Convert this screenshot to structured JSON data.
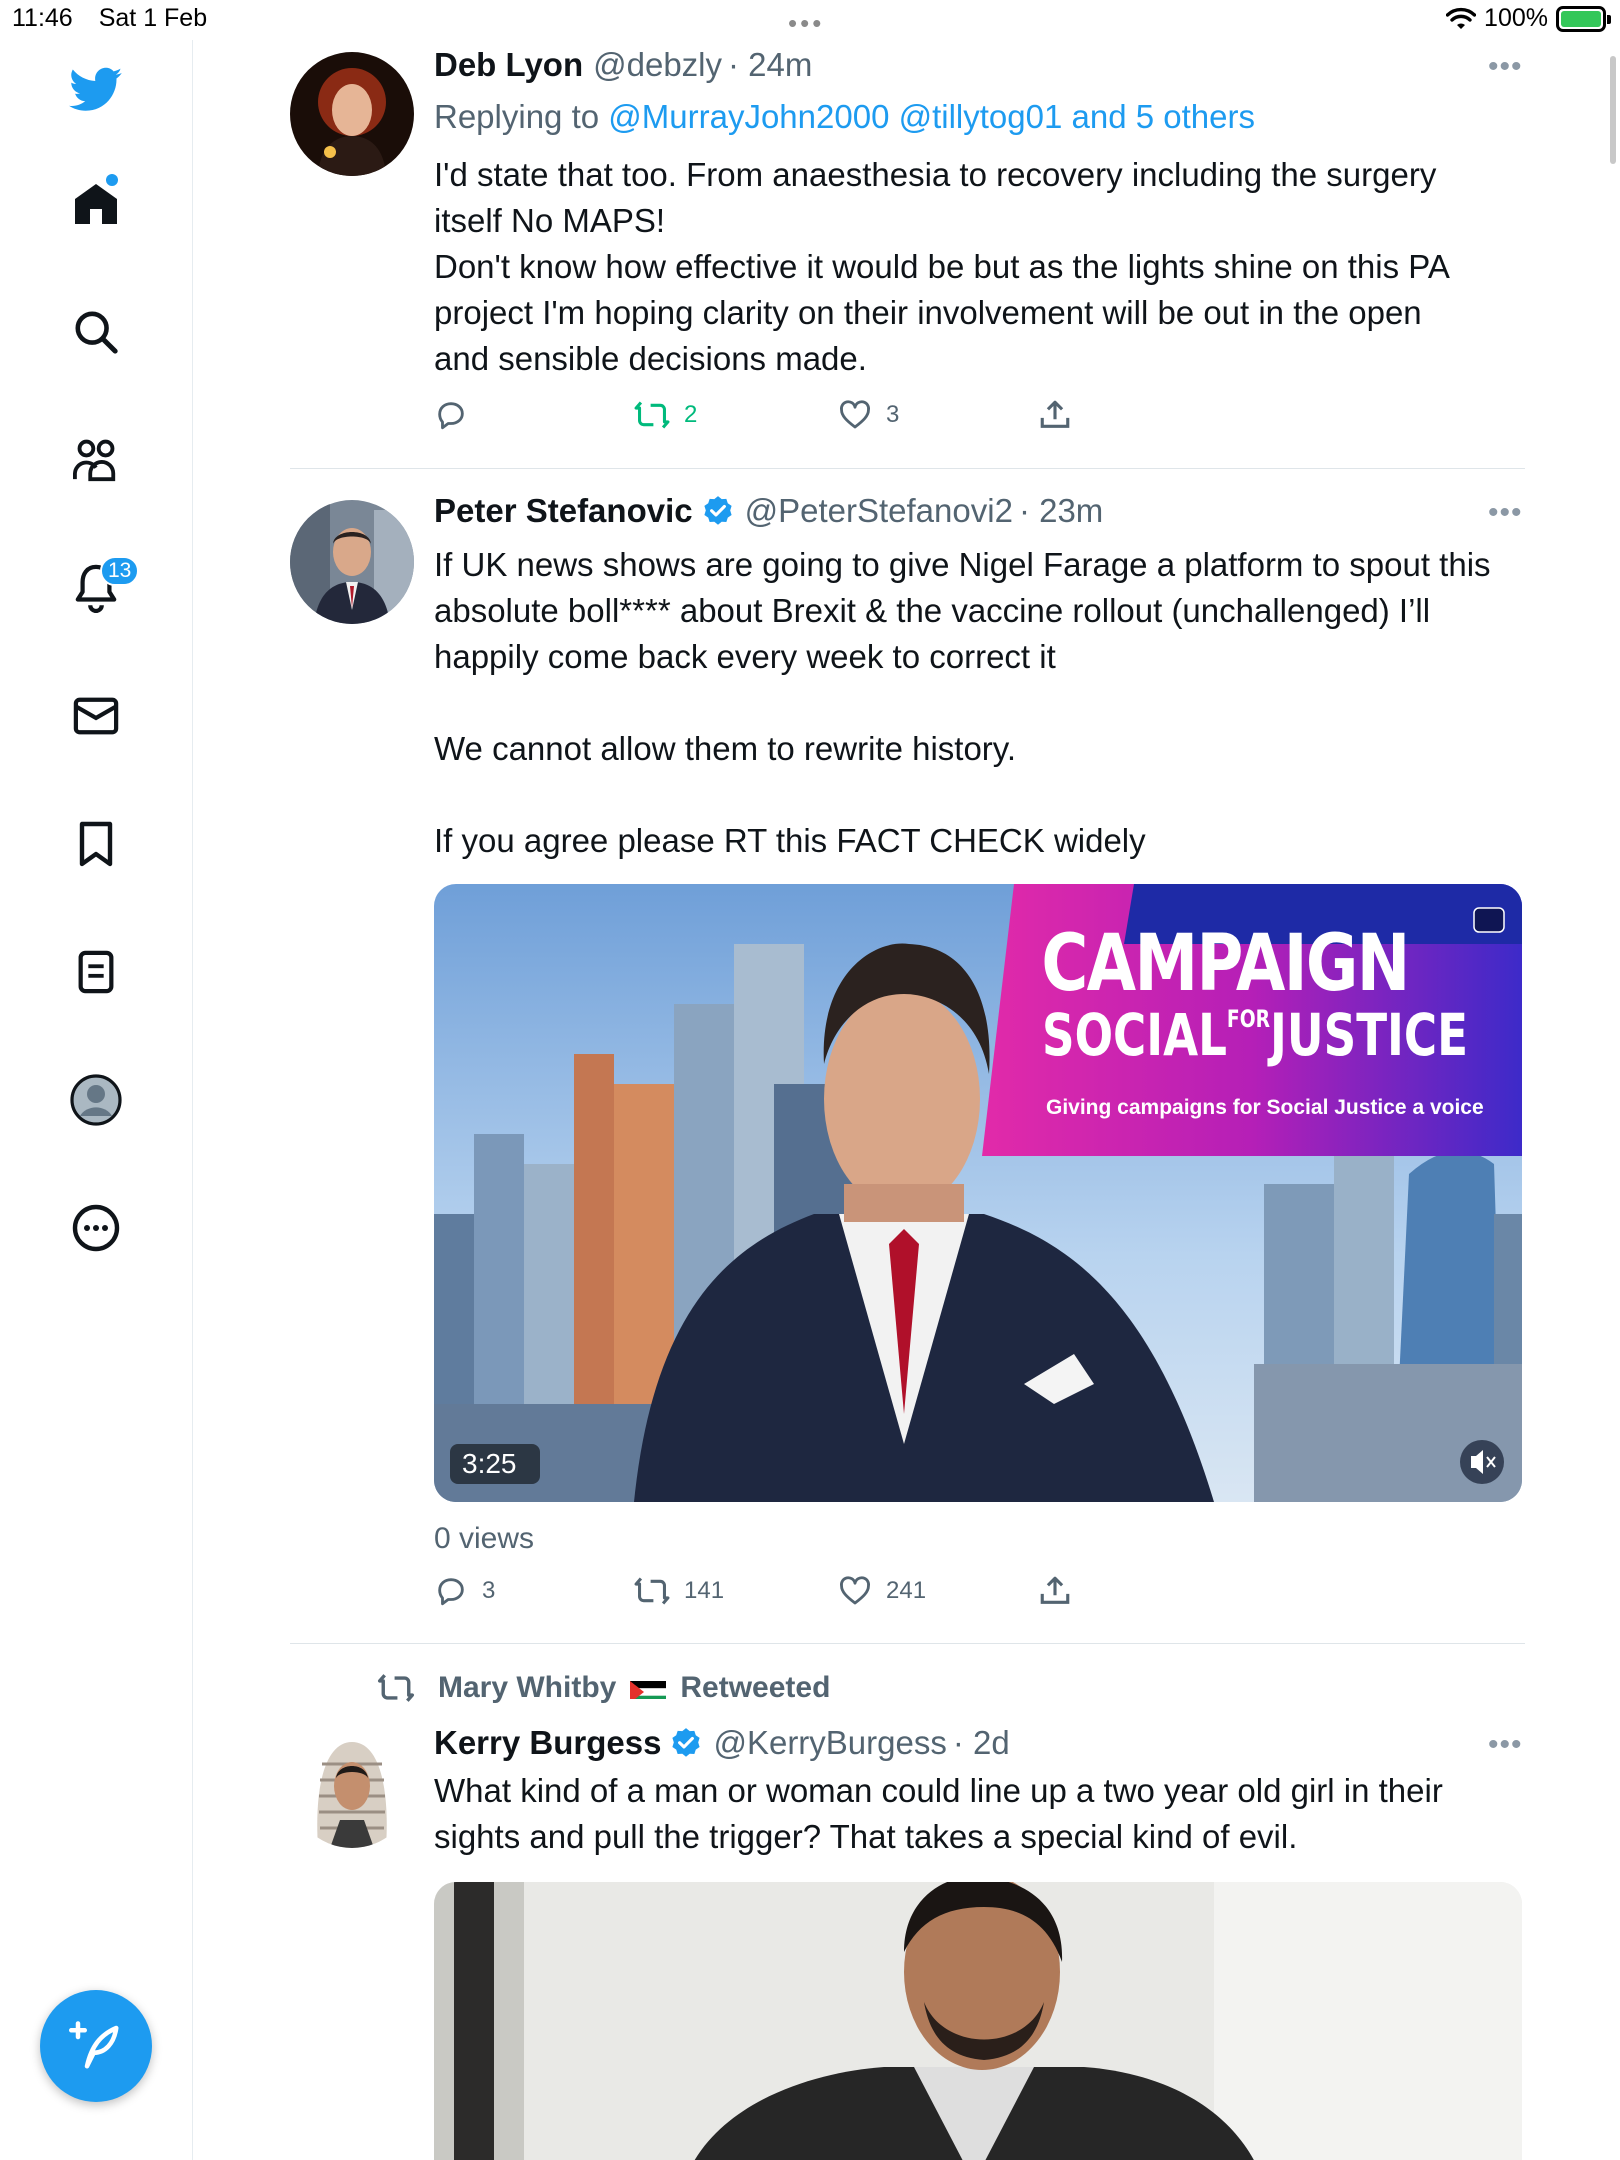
{
  "status_bar": {
    "time": "11:46",
    "date": "Sat 1 Feb",
    "battery": "100%"
  },
  "sidebar": {
    "items": [
      {
        "name": "home",
        "icon": "home-icon"
      },
      {
        "name": "search",
        "icon": "search-icon"
      },
      {
        "name": "communities",
        "icon": "communities-icon"
      },
      {
        "name": "notifications",
        "icon": "bell-icon",
        "badge": "13"
      },
      {
        "name": "messages",
        "icon": "mail-icon"
      },
      {
        "name": "bookmarks",
        "icon": "bookmark-icon"
      },
      {
        "name": "lists",
        "icon": "list-icon"
      },
      {
        "name": "profile",
        "icon": "profile-icon"
      },
      {
        "name": "more",
        "icon": "more-circle-icon"
      }
    ],
    "notification_badge": "13"
  },
  "tweets": [
    {
      "name": "Deb Lyon",
      "handle": "@debzly",
      "time": "· 24m",
      "replying_prefix": "Replying to",
      "replying_links": "@MurrayJohn2000 @tillytog01 and 5 others",
      "lines": [
        "I'd state that too. From anaesthesia to recovery including the surgery",
        "itself No MAPS!",
        "Don't know how effective it would be but as the lights shine on this PA",
        "project I'm hoping clarity on their involvement will be out in the open",
        "and sensible decisions made."
      ],
      "retweets": "2",
      "likes": "3"
    },
    {
      "name": "Peter Stefanovic",
      "handle": "@PeterStefanovi2",
      "time": "· 23m",
      "lines": [
        "If UK news shows are going to give Nigel Farage a platform to spout this",
        "absolute boll**** about Brexit & the vaccine rollout (unchallenged) I’ll",
        "happily come back every week to correct it",
        "",
        "We cannot allow them to rewrite history.",
        "",
        "If you agree please RT this FACT CHECK widely"
      ],
      "video": {
        "banner_title": "CAMPAIGN",
        "banner_sub_left": "SOCIAL",
        "banner_sub_for": "FOR",
        "banner_sub_right": "JUSTICE",
        "banner_tagline": "Giving campaigns for Social Justice a voice",
        "duration": "3:25"
      },
      "views": "0 views",
      "replies": "3",
      "retweets": "141",
      "likes": "241"
    },
    {
      "retweeted_by": "Mary Whitby",
      "retweeted_label": "Retweeted",
      "name": "Kerry Burgess",
      "handle": "@KerryBurgess",
      "time": "· 2d",
      "lines": [
        "What kind of a man or woman could line up a two year old girl in their",
        "sights and pull the trigger? That takes  a special kind of evil."
      ]
    }
  ],
  "colors": {
    "accent": "#1d9bf0",
    "retweet_active": "#00ba7c",
    "text": "#0f1419",
    "muted": "#536471"
  }
}
